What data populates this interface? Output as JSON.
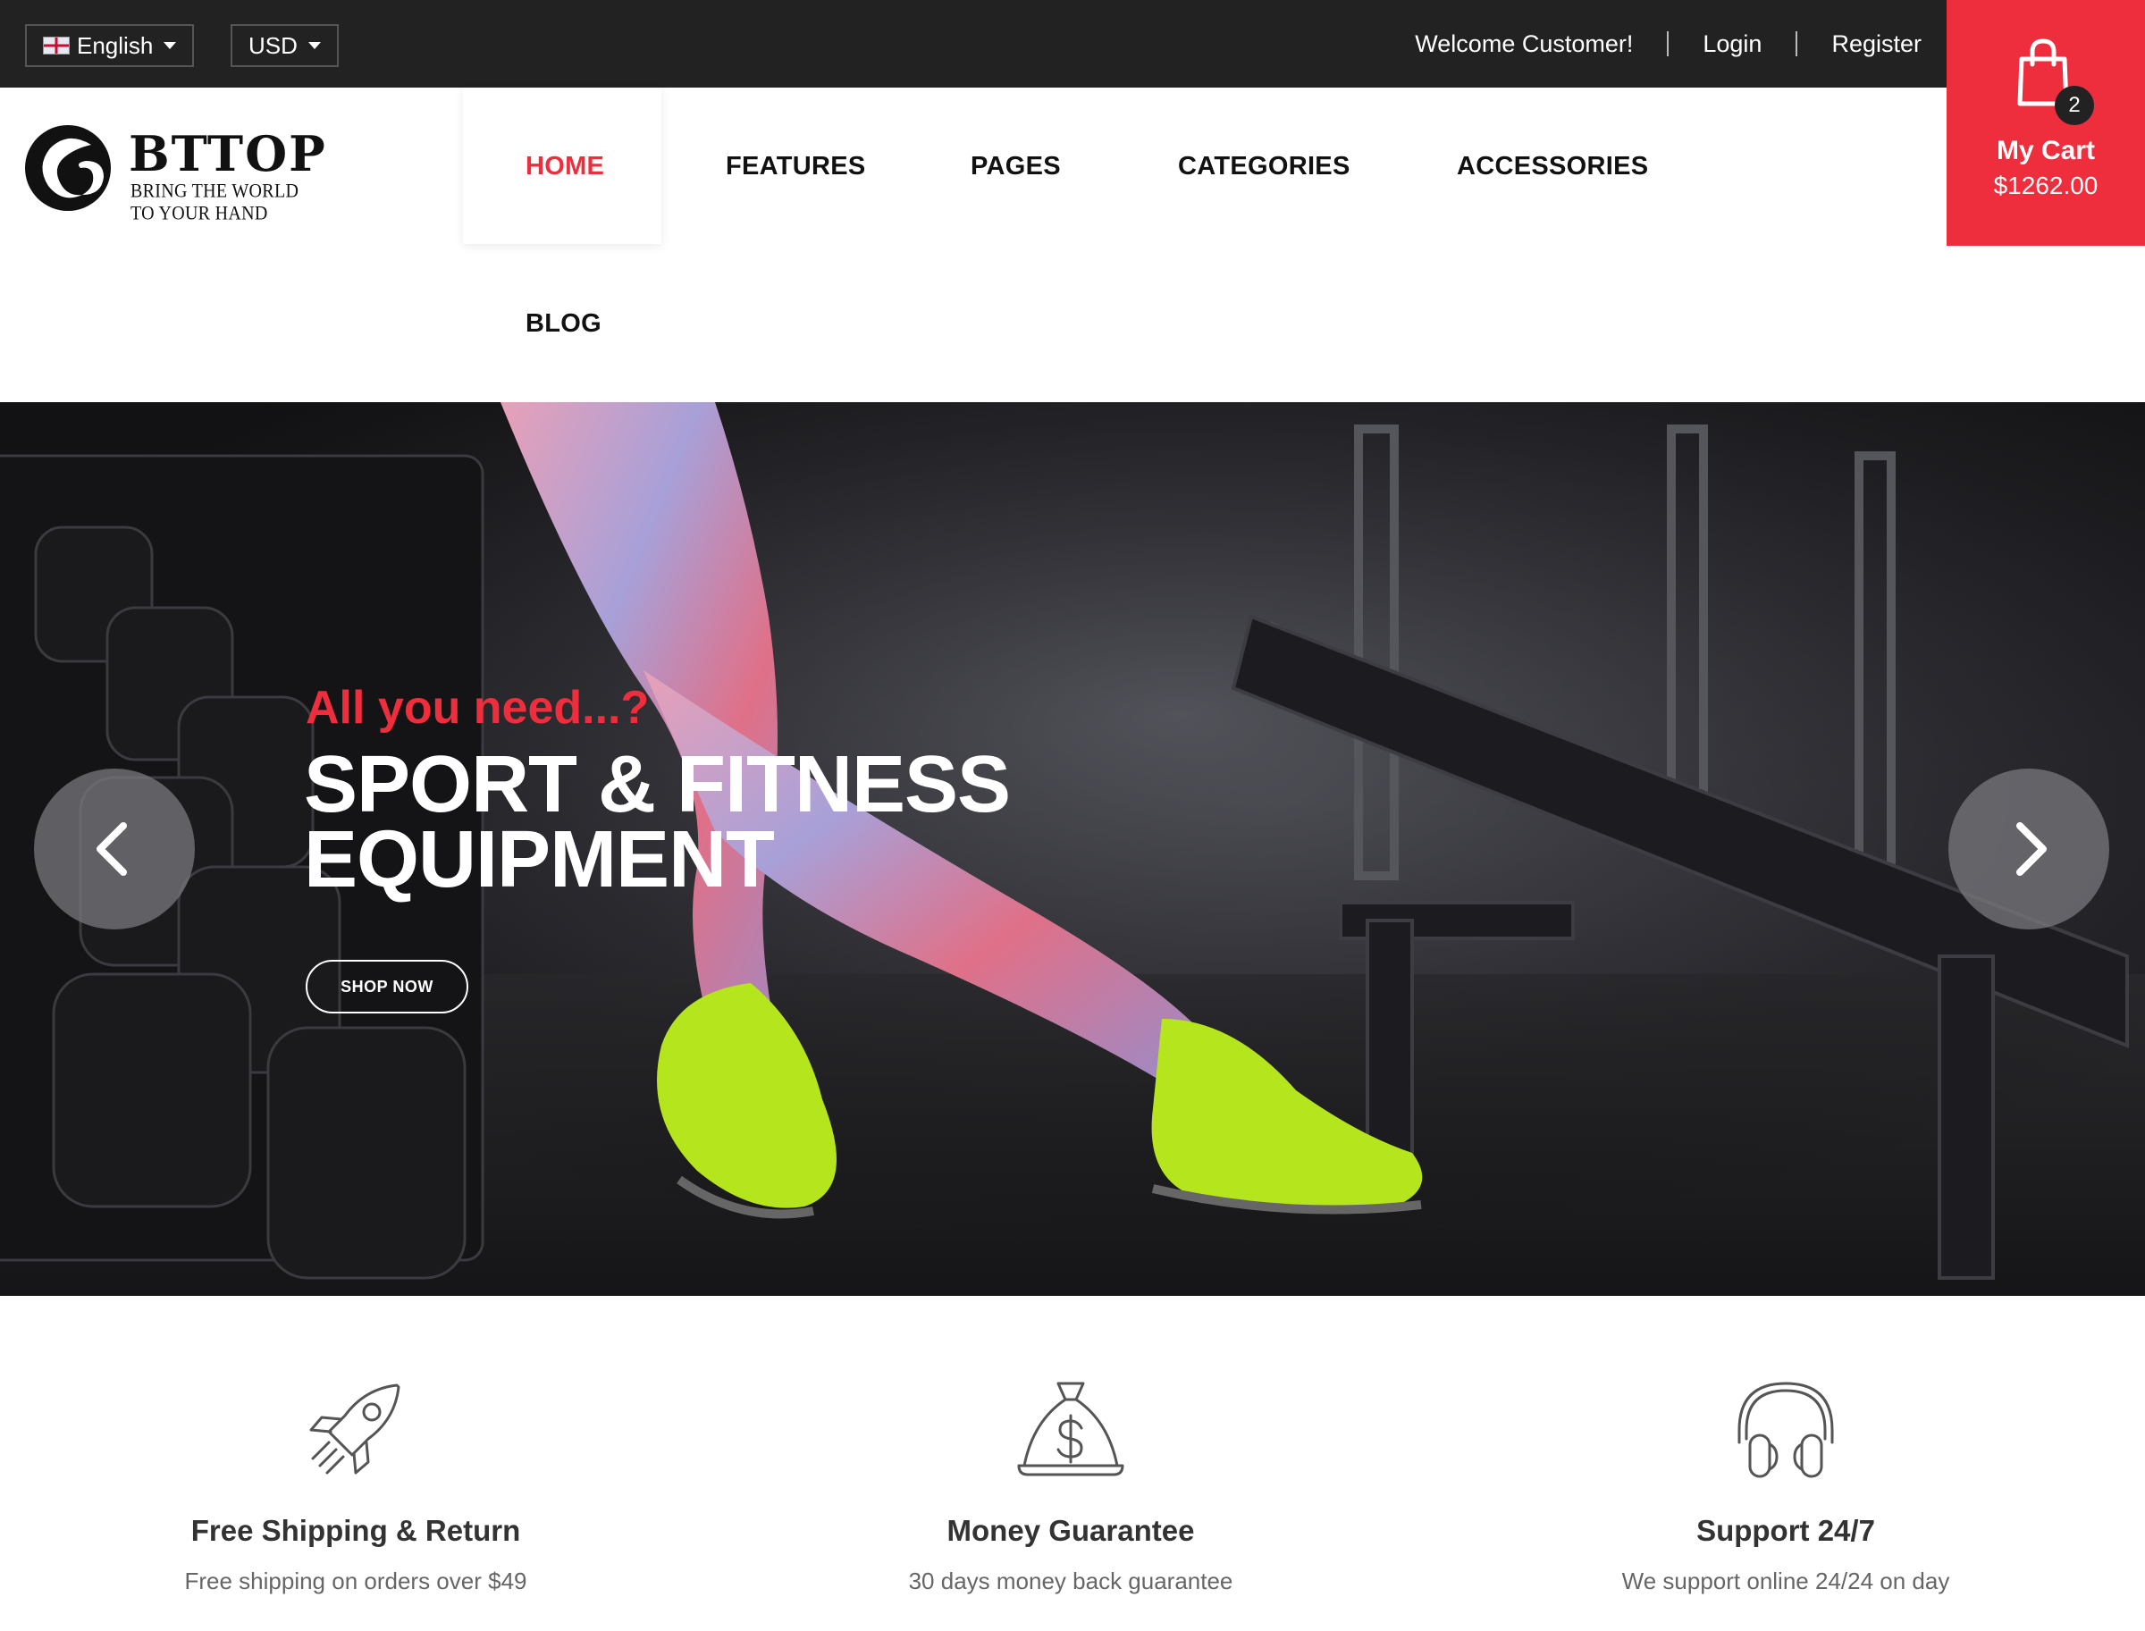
{
  "topbar": {
    "language": "English",
    "currency": "USD",
    "welcome": "Welcome Customer!",
    "login": "Login",
    "register": "Register"
  },
  "cart": {
    "count": "2",
    "title": "My Cart",
    "total": "$1262.00",
    "icon": "shopping-bag-icon"
  },
  "logo": {
    "name": "BTTOP",
    "tagline": "BRING THE WORLD TO YOUR HAND"
  },
  "nav": {
    "items": [
      {
        "label": "HOME",
        "active": true
      },
      {
        "label": "FEATURES"
      },
      {
        "label": "PAGES"
      },
      {
        "label": "CATEGORIES"
      },
      {
        "label": "ACCESSORIES"
      },
      {
        "label": "BLOG"
      }
    ]
  },
  "hero": {
    "subtitle": "All you need...?",
    "title_line1": "SPORT & FITNESS",
    "title_line2": "EQUIPMENT",
    "button": "SHOP NOW"
  },
  "features": [
    {
      "icon": "rocket-icon",
      "title": "Free Shipping & Return",
      "desc": "Free shipping on orders over $49"
    },
    {
      "icon": "money-bag-icon",
      "title": "Money Guarantee",
      "desc": "30 days money back guarantee"
    },
    {
      "icon": "headphones-icon",
      "title": "Support 24/7",
      "desc": "We support online 24/24 on day"
    }
  ],
  "colors": {
    "accent": "#ee2e3c",
    "topbar": "#222222"
  }
}
